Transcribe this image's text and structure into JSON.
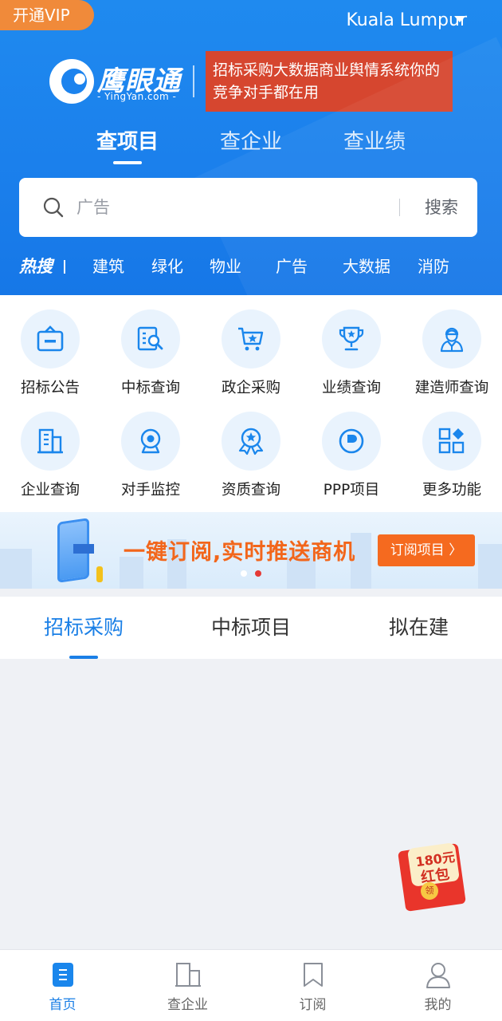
{
  "header": {
    "vip_label": "开通VIP",
    "city": "Kuala Lumpur",
    "logo": {
      "name": "鹰眼通",
      "url": "- YingYan.com -"
    },
    "ad_text": "招标采购大数据商业舆情系统你的竞争对手都在用",
    "tabs": [
      {
        "label": "查项目",
        "active": true
      },
      {
        "label": "查企业",
        "active": false
      },
      {
        "label": "查业绩",
        "active": false
      }
    ],
    "search": {
      "placeholder": "广告",
      "button": "搜索"
    },
    "hot_label": "热搜",
    "hot_words": [
      "建筑",
      "绿化",
      "物业",
      "广告",
      "大数据",
      "消防"
    ]
  },
  "features": [
    {
      "label": "招标公告",
      "icon": "briefcase-icon"
    },
    {
      "label": "中标查询",
      "icon": "document-search-icon"
    },
    {
      "label": "政企采购",
      "icon": "shopping-cart-icon"
    },
    {
      "label": "业绩查询",
      "icon": "trophy-icon"
    },
    {
      "label": "建造师查询",
      "icon": "worker-icon"
    },
    {
      "label": "企业查询",
      "icon": "building-icon"
    },
    {
      "label": "对手监控",
      "icon": "webcam-icon"
    },
    {
      "label": "资质查询",
      "icon": "award-badge-icon"
    },
    {
      "label": "PPP项目",
      "icon": "ppp-icon"
    },
    {
      "label": "更多功能",
      "icon": "grid-more-icon"
    }
  ],
  "banner": {
    "text": "一键订阅,实时推送商机",
    "button": "订阅项目 〉",
    "dots": [
      {
        "active": false
      },
      {
        "active": true
      }
    ]
  },
  "content_tabs": [
    {
      "label": "招标采购",
      "active": true
    },
    {
      "label": "中标项目",
      "active": false
    },
    {
      "label": "拟在建",
      "active": false
    }
  ],
  "red_packet": {
    "amount": "180元",
    "label": "红包",
    "coin": "领"
  },
  "bottom_nav": [
    {
      "label": "首页",
      "icon": "home-icon",
      "active": true
    },
    {
      "label": "查企业",
      "icon": "company-icon",
      "active": false
    },
    {
      "label": "订阅",
      "icon": "bookmark-icon",
      "active": false
    },
    {
      "label": "我的",
      "icon": "user-icon",
      "active": false
    }
  ],
  "colors": {
    "brand_blue": "#1b80ec",
    "accent_orange": "#f56a1f",
    "vip_orange": "#f08a3a",
    "ad_red": "#d6462f",
    "active_tab": "#1a7fe6"
  }
}
